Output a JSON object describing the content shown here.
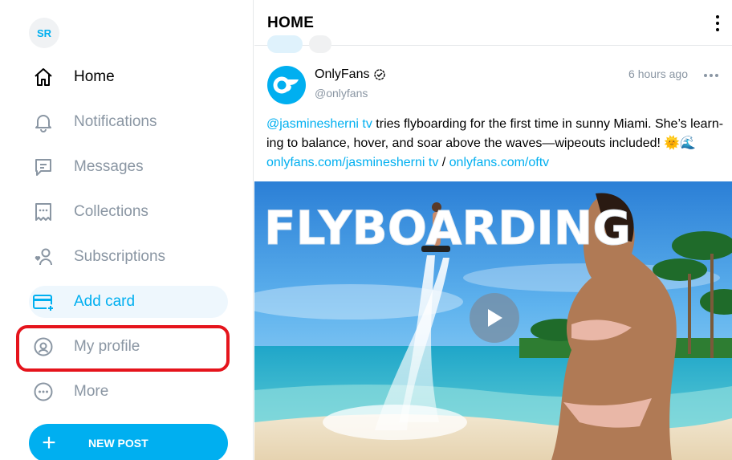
{
  "user": {
    "initials": "SR"
  },
  "sidebar": {
    "items": [
      {
        "label": "Home"
      },
      {
        "label": "Notifications"
      },
      {
        "label": "Messages"
      },
      {
        "label": "Collections"
      },
      {
        "label": "Subscriptions"
      },
      {
        "label": "Add card"
      },
      {
        "label": "My profile"
      },
      {
        "label": "More"
      }
    ],
    "new_post_label": "NEW POST"
  },
  "header": {
    "title": "HOME"
  },
  "post": {
    "author_name": "OnlyFans",
    "author_handle": "@onlyfans",
    "time": "6 hours ago",
    "mention": "@jasminesherni tv",
    "text_body": " tries flyboarding for the first time in sunny Miami. She’s learn-ing to balance, hover, and soar above the waves—wipeouts included! 🌞🌊",
    "link_1": "onlyfans.com/jasminesherni tv",
    "link_separator": " / ",
    "link_2": "onlyfans.com/oftv",
    "media_title": "FLYBOARDING"
  },
  "colors": {
    "accent": "#00aff0",
    "muted": "#8a96a3",
    "highlight": "#e5141c"
  }
}
